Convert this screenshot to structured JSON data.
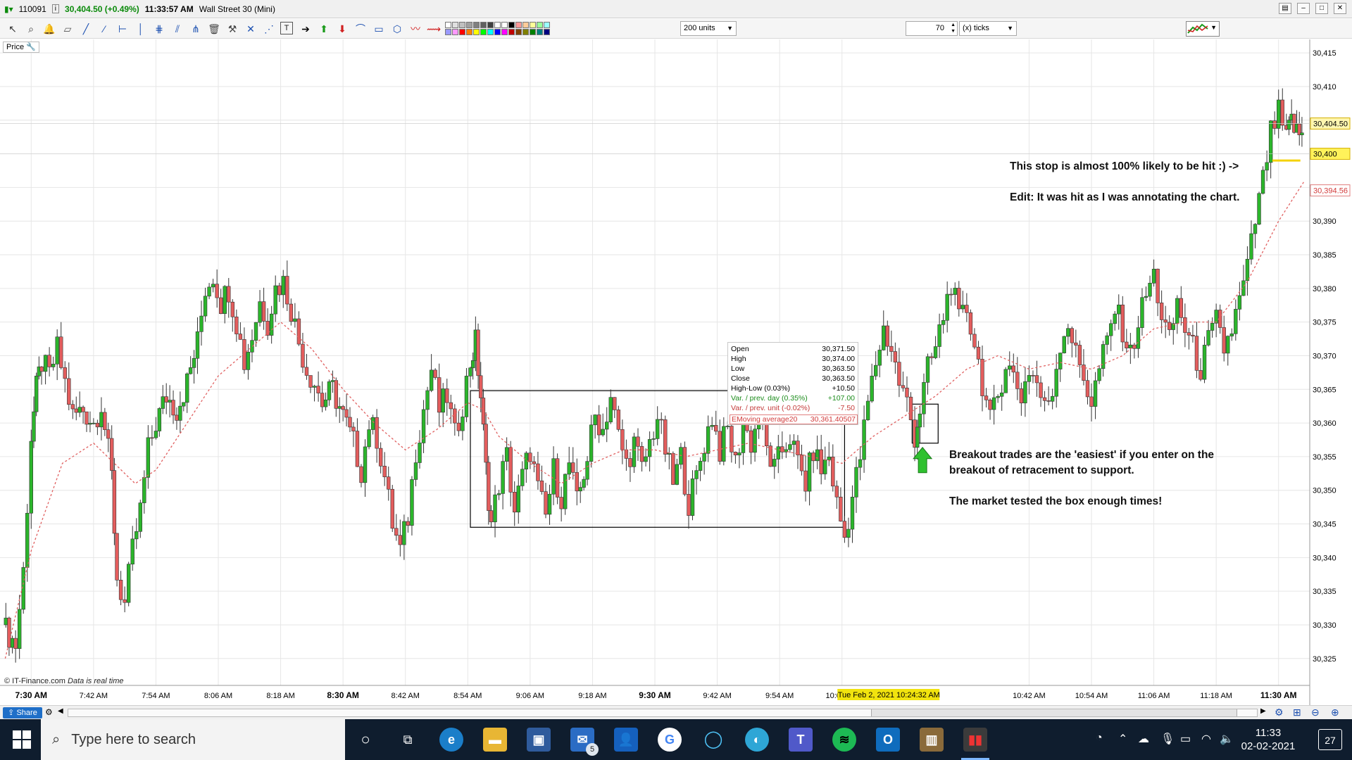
{
  "titlebar": {
    "account": "110091",
    "price": "30,404.50 (+0.49%)",
    "time": "11:33:57 AM",
    "instrument": "Wall Street 30 (Mini)"
  },
  "toolbar": {
    "units_select": "200 units",
    "ticks_value": "70",
    "ticks_select": "(x) ticks",
    "swatches": [
      "#ffffff",
      "#e0e0e0",
      "#c0c0c0",
      "#a0a0a0",
      "#808080",
      "#606060",
      "#404040",
      "#ffffff",
      "#ffffff",
      "#000000",
      "#ff9999",
      "#ffcc99",
      "#ffff99",
      "#99ff99",
      "#99ffff",
      "#9999ff",
      "#ff99ff",
      "#ff0000",
      "#ff8000",
      "#ffff00",
      "#00ff00",
      "#00ffff",
      "#0000ff",
      "#ff00ff",
      "#c00000",
      "#804000",
      "#808000",
      "#008000",
      "#008080",
      "#000080"
    ]
  },
  "chart": {
    "price_label": "Price",
    "copyright": "© IT-Finance.com",
    "realtime_note": "Data is real time",
    "price_tags": [
      {
        "text": "30,404.50",
        "value": 30404.5,
        "style": "current"
      },
      {
        "text": "30,400",
        "value": 30400,
        "style": "stop"
      },
      {
        "text": "30,394.56",
        "value": 30394.56,
        "style": "ema"
      }
    ],
    "cursor_time_label": "Tue Feb 2, 2021 10:24:32 AM",
    "info_box": {
      "rows": [
        {
          "label": "Open",
          "value": "30,371.50",
          "color": "black"
        },
        {
          "label": "High",
          "value": "30,374.00",
          "color": "black"
        },
        {
          "label": "Low",
          "value": "30,363.50",
          "color": "black"
        },
        {
          "label": "Close",
          "value": "30,363.50",
          "color": "black"
        },
        {
          "label": "High-Low (0.03%)",
          "value": "+10.50",
          "color": "black"
        },
        {
          "label": "Var. / prev. day (0.35%)",
          "value": "+107.00",
          "color": "green"
        },
        {
          "label": "Var. / prev. unit (-0.02%)",
          "value": "-7.50",
          "color": "red"
        }
      ],
      "ema_label": "EMoving average20",
      "ema_value": "30,361.40507"
    },
    "annotations": {
      "stop_note": "This stop is almost 100% likely to be hit :) ->",
      "edit_note": "Edit: It was hit as I was annotating the chart.",
      "breakout_line1": "Breakout trades are the 'easiest' if you enter on the",
      "breakout_line2": "breakout of retracement to support.",
      "tested_note": "The market tested the box enough times!"
    }
  },
  "chart_data": {
    "type": "candlestick",
    "title": "",
    "xlabel": "",
    "ylabel": "",
    "ylim": [
      30321,
      30417
    ],
    "y_ticks": [
      30325,
      30330,
      30335,
      30340,
      30345,
      30350,
      30355,
      30360,
      30365,
      30370,
      30375,
      30380,
      30385,
      30390,
      30395,
      30400,
      30405,
      30410,
      30415
    ],
    "y_tick_labels": [
      "30,325",
      "30,330",
      "30,335",
      "30,340",
      "30,345",
      "30,350",
      "30,355",
      "30,360",
      "30,365",
      "30,370",
      "30,375",
      "30,380",
      "30,385",
      "30,390",
      "30,395",
      "30,400",
      "30,405",
      "30,410",
      "30,415"
    ],
    "x_range_minutes": [
      444,
      696
    ],
    "x_ticks": [
      {
        "label": "7:30 AM",
        "minute": 450,
        "bold": true
      },
      {
        "label": "7:42 AM",
        "minute": 462,
        "bold": false
      },
      {
        "label": "7:54 AM",
        "minute": 474,
        "bold": false
      },
      {
        "label": "8:06 AM",
        "minute": 486,
        "bold": false
      },
      {
        "label": "8:18 AM",
        "minute": 498,
        "bold": false
      },
      {
        "label": "8:30 AM",
        "minute": 510,
        "bold": true
      },
      {
        "label": "8:42 AM",
        "minute": 522,
        "bold": false
      },
      {
        "label": "8:54 AM",
        "minute": 534,
        "bold": false
      },
      {
        "label": "9:06 AM",
        "minute": 546,
        "bold": false
      },
      {
        "label": "9:18 AM",
        "minute": 558,
        "bold": false
      },
      {
        "label": "9:30 AM",
        "minute": 570,
        "bold": true
      },
      {
        "label": "9:42 AM",
        "minute": 582,
        "bold": false
      },
      {
        "label": "9:54 AM",
        "minute": 594,
        "bold": false
      },
      {
        "label": "10:06 AM",
        "minute": 606,
        "bold": false
      },
      {
        "label": "10:42 AM",
        "minute": 642,
        "bold": false
      },
      {
        "label": "10:54 AM",
        "minute": 654,
        "bold": false
      },
      {
        "label": "11:06 AM",
        "minute": 666,
        "bold": false
      },
      {
        "label": "11:18 AM",
        "minute": 678,
        "bold": false
      },
      {
        "label": "11:30 AM",
        "minute": 690,
        "bold": true
      }
    ],
    "series_path": [
      [
        444.5,
        30330
      ],
      [
        447,
        30327
      ],
      [
        448.5,
        30338
      ],
      [
        450,
        30358
      ],
      [
        451,
        30365
      ],
      [
        452,
        30369
      ],
      [
        453.5,
        30367
      ],
      [
        455,
        30371
      ],
      [
        456.5,
        30366
      ],
      [
        458,
        30361
      ],
      [
        460,
        30362
      ],
      [
        462,
        30360
      ],
      [
        463.5,
        30363
      ],
      [
        465.5,
        30352
      ],
      [
        466.5,
        30337
      ],
      [
        468,
        30333
      ],
      [
        469.5,
        30341
      ],
      [
        471,
        30347
      ],
      [
        472.5,
        30356
      ],
      [
        474,
        30360
      ],
      [
        476,
        30364
      ],
      [
        478,
        30362
      ],
      [
        480,
        30366
      ],
      [
        482,
        30372
      ],
      [
        483.5,
        30380
      ],
      [
        485,
        30382
      ],
      [
        486.5,
        30378
      ],
      [
        488,
        30380
      ],
      [
        489.5,
        30375
      ],
      [
        491,
        30369
      ],
      [
        492.5,
        30373
      ],
      [
        494,
        30378
      ],
      [
        495.5,
        30375
      ],
      [
        497,
        30380
      ],
      [
        498.5,
        30381
      ],
      [
        500,
        30377
      ],
      [
        501.5,
        30372
      ],
      [
        503,
        30368
      ],
      [
        504.5,
        30366
      ],
      [
        506,
        30363
      ],
      [
        508,
        30365
      ],
      [
        510,
        30361
      ],
      [
        512,
        30357
      ],
      [
        513.5,
        30353
      ],
      [
        515,
        30360
      ],
      [
        516.5,
        30358
      ],
      [
        518,
        30352
      ],
      [
        519.5,
        30345
      ],
      [
        521,
        30341
      ],
      [
        522.5,
        30346
      ],
      [
        524,
        30356
      ],
      [
        525.5,
        30362
      ],
      [
        527,
        30368
      ],
      [
        528.5,
        30362
      ],
      [
        530,
        30364
      ],
      [
        531.5,
        30358
      ],
      [
        533,
        30363
      ],
      [
        534.5,
        30369
      ],
      [
        535.5,
        30372
      ],
      [
        536.5,
        30364
      ],
      [
        537.5,
        30353
      ],
      [
        538.5,
        30345
      ],
      [
        540,
        30351
      ],
      [
        541.5,
        30355
      ],
      [
        543,
        30347
      ],
      [
        544.5,
        30352
      ],
      [
        546,
        30356
      ],
      [
        547.5,
        30350
      ],
      [
        549,
        30346
      ],
      [
        550.5,
        30353
      ],
      [
        552,
        30349
      ],
      [
        553.5,
        30354
      ],
      [
        555,
        30348
      ],
      [
        557,
        30355
      ],
      [
        558.5,
        30361
      ],
      [
        560,
        30359
      ],
      [
        561.5,
        30364
      ],
      [
        563,
        30358
      ],
      [
        564.5,
        30354
      ],
      [
        566,
        30357
      ],
      [
        567.5,
        30353
      ],
      [
        569,
        30357
      ],
      [
        570.5,
        30361
      ],
      [
        572,
        30356
      ],
      [
        573.5,
        30351
      ],
      [
        575,
        30355
      ],
      [
        576.5,
        30348
      ],
      [
        578,
        30352
      ],
      [
        579.5,
        30357
      ],
      [
        581,
        30361
      ],
      [
        582.5,
        30356
      ],
      [
        584,
        30359
      ],
      [
        585.5,
        30354
      ],
      [
        587,
        30360
      ],
      [
        588.5,
        30357
      ],
      [
        590,
        30361
      ],
      [
        591.5,
        30356
      ],
      [
        593,
        30353
      ],
      [
        594.5,
        30356
      ],
      [
        596,
        30358
      ],
      [
        597.5,
        30354
      ],
      [
        599,
        30351
      ],
      [
        600.5,
        30356
      ],
      [
        602,
        30353
      ],
      [
        603.5,
        30355
      ],
      [
        605,
        30348
      ],
      [
        606.5,
        30343
      ],
      [
        608,
        30349
      ],
      [
        609.5,
        30355
      ],
      [
        611,
        30363
      ],
      [
        612.5,
        30369
      ],
      [
        614,
        30374
      ],
      [
        615.5,
        30371
      ],
      [
        617,
        30366
      ],
      [
        618.5,
        30363
      ],
      [
        620,
        30358
      ],
      [
        621,
        30362
      ],
      [
        622.5,
        30368
      ],
      [
        624,
        30371
      ],
      [
        625.5,
        30376
      ],
      [
        627,
        30381
      ],
      [
        628.5,
        30375
      ],
      [
        630,
        30377
      ],
      [
        631.5,
        30372
      ],
      [
        633,
        30366
      ],
      [
        634.5,
        30360
      ],
      [
        636,
        30364
      ],
      [
        637.5,
        30369
      ],
      [
        639,
        30367
      ],
      [
        640.5,
        30364
      ],
      [
        642,
        30368
      ],
      [
        643.5,
        30366
      ],
      [
        645,
        30362
      ],
      [
        646.5,
        30365
      ],
      [
        648,
        30372
      ],
      [
        649.5,
        30375
      ],
      [
        651,
        30370
      ],
      [
        652.5,
        30367
      ],
      [
        654,
        30363
      ],
      [
        655.5,
        30368
      ],
      [
        657,
        30372
      ],
      [
        658.5,
        30377
      ],
      [
        660,
        30374
      ],
      [
        661.5,
        30370
      ],
      [
        663,
        30375
      ],
      [
        664.5,
        30379
      ],
      [
        666,
        30382
      ],
      [
        667.5,
        30376
      ],
      [
        669,
        30372
      ],
      [
        670.5,
        30378
      ],
      [
        672,
        30374
      ],
      [
        673.5,
        30371
      ],
      [
        675,
        30368
      ],
      [
        676.5,
        30372
      ],
      [
        678,
        30375
      ],
      [
        679.5,
        30371
      ],
      [
        681,
        30374
      ],
      [
        682.5,
        30378
      ],
      [
        684,
        30383
      ],
      [
        685.5,
        30390
      ],
      [
        687,
        30396
      ],
      [
        688.5,
        30403
      ],
      [
        690,
        30406
      ],
      [
        691.5,
        30402
      ],
      [
        692.5,
        30405
      ],
      [
        693.5,
        30403
      ],
      [
        694.5,
        30403
      ]
    ],
    "ema20_series": [
      [
        445,
        30325
      ],
      [
        450,
        30341
      ],
      [
        456,
        30354
      ],
      [
        462,
        30357
      ],
      [
        466,
        30354
      ],
      [
        470,
        30351
      ],
      [
        474,
        30353
      ],
      [
        480,
        30360
      ],
      [
        486,
        30367
      ],
      [
        492,
        30371
      ],
      [
        498,
        30375
      ],
      [
        504,
        30371
      ],
      [
        510,
        30365
      ],
      [
        516,
        30360
      ],
      [
        522,
        30356
      ],
      [
        528,
        30359
      ],
      [
        534,
        30363
      ],
      [
        537,
        30362
      ],
      [
        540,
        30358
      ],
      [
        546,
        30354
      ],
      [
        552,
        30351
      ],
      [
        558,
        30354
      ],
      [
        564,
        30356
      ],
      [
        570,
        30356
      ],
      [
        576,
        30355
      ],
      [
        582,
        30356
      ],
      [
        588,
        30357
      ],
      [
        594,
        30356
      ],
      [
        600,
        30355
      ],
      [
        606,
        30354
      ],
      [
        612,
        30358
      ],
      [
        618,
        30361
      ],
      [
        624,
        30364
      ],
      [
        630,
        30368
      ],
      [
        636,
        30370
      ],
      [
        642,
        30368
      ],
      [
        648,
        30369
      ],
      [
        654,
        30368
      ],
      [
        660,
        30370
      ],
      [
        666,
        30374
      ],
      [
        672,
        30375
      ],
      [
        678,
        30375
      ],
      [
        684,
        30381
      ],
      [
        690,
        30390
      ],
      [
        695,
        30396
      ]
    ],
    "consolidation_box": {
      "t0": 534.5,
      "t1": 606.5,
      "p_low": 30344.5,
      "p_high": 30364.8
    },
    "retracement_box": {
      "t0": 619.5,
      "t1": 624.5,
      "p_low": 30357,
      "p_high": 30362.8
    },
    "stop_level": {
      "t0": 688.8,
      "t1": 694.2,
      "price": 30399
    },
    "cursor_minute": 624.5
  },
  "scrollbar": {
    "share_label": "Share"
  },
  "taskbar": {
    "search_placeholder": "Type here to search",
    "mail_badge": "5",
    "clock_time": "11:33",
    "clock_date": "02-02-2021",
    "notifications": "27"
  }
}
